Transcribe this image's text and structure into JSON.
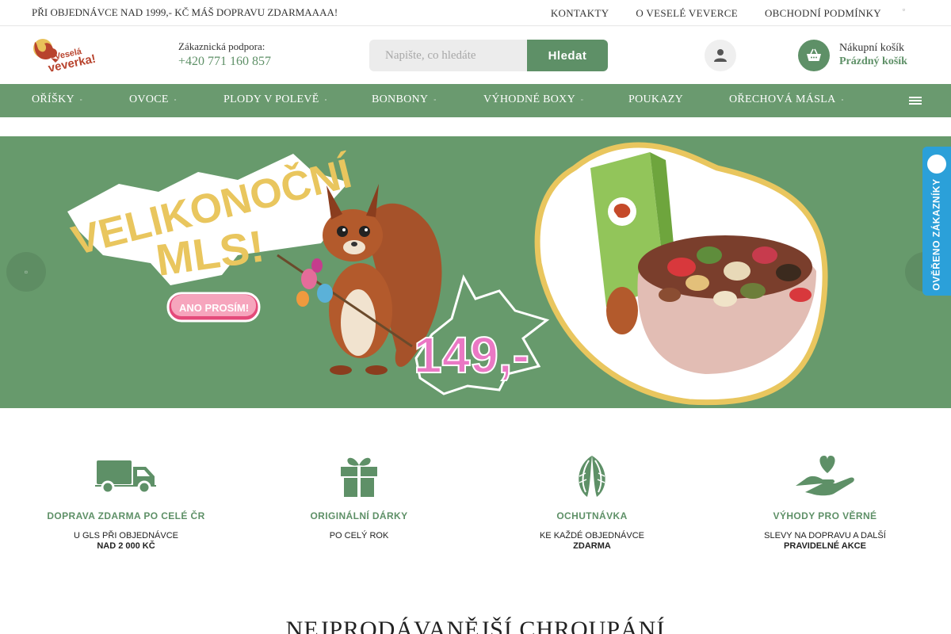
{
  "topbar": {
    "promo": "PŘI OBJEDNÁVCE NAD 1999,- KČ MÁŠ DOPRAVU ZDARMAAAA!",
    "links": [
      "KONTAKTY",
      "O VESELÉ VEVERCE",
      "OBCHODNÍ PODMÍNKY"
    ]
  },
  "header": {
    "support_label": "Zákaznická podpora:",
    "support_phone": "+420 771 160 857",
    "search_placeholder": "Napište, co hledáte",
    "search_button": "Hledat",
    "cart_title": "Nákupní košík",
    "cart_status": "Prázdný košík",
    "logo_text": "Veselá veverka!"
  },
  "nav": {
    "items": [
      "OŘÍŠKY",
      "OVOCE",
      "PLODY V POLEVĚ",
      "BONBONY",
      "VÝHODNÉ BOXY",
      "POUKAZY",
      "OŘECHOVÁ MÁSLA"
    ]
  },
  "hero": {
    "headline_1": "VELIKONOČNÍ",
    "headline_2": "MLS!",
    "cta": "ANO PROSÍM!",
    "price": "149,-"
  },
  "badge": {
    "text": "OVĚŘENO ZÁKAZNÍKY"
  },
  "features": [
    {
      "icon": "truck-icon",
      "title": "DOPRAVA ZDARMA PO CELÉ ČR",
      "line1": "U GLS PŘI OBJEDNÁVCE",
      "line2": "NAD 2 000 KČ"
    },
    {
      "icon": "gift-icon",
      "title": "ORIGINÁLNÍ DÁRKY",
      "line1": "PO CELÝ ROK",
      "line2": ""
    },
    {
      "icon": "almond-icon",
      "title": "OCHUTNÁVKA",
      "line1": "KE KAŽDÉ OBJEDNÁVCE",
      "line2": "ZDARMA"
    },
    {
      "icon": "heart-hand-icon",
      "title": "VÝHODY PRO VĚRNÉ",
      "line1": "SLEVY NA DOPRAVU A DALŠÍ",
      "line2": "PRAVIDELNÉ AKCE"
    }
  ],
  "section": {
    "title": "NEJPRODÁVANĚJŠÍ CHROUPÁNÍ"
  },
  "colors": {
    "brand_green": "#5e9067",
    "nav_green": "#6a9a6f",
    "badge_blue": "#2ba0d9"
  }
}
